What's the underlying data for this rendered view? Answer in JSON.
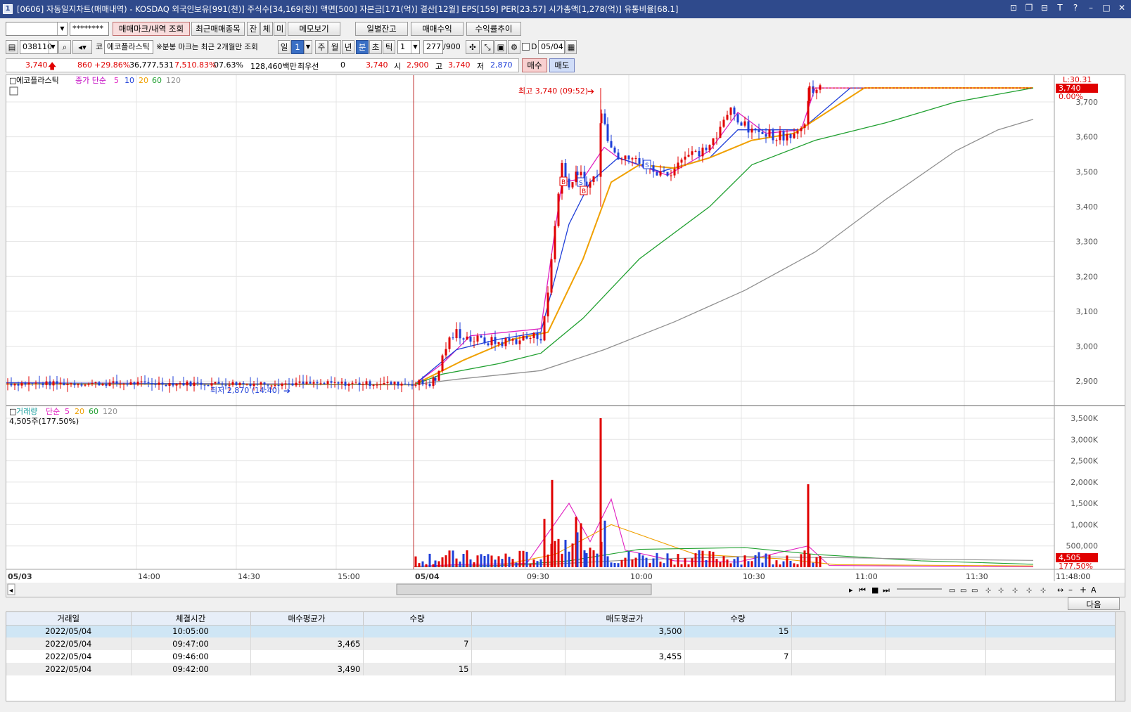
{
  "window": {
    "screen_no": "1",
    "title": "[0606] 자동일지차트(매매내역) - KOSDAQ 외국인보유[991(천)] 주식수[34,169(천)] 액면[500] 자본금[171(억)] 결산[12월] EPS[159] PER[23.57] 시가총액[1,278(억)] 유통비율[68.1]"
  },
  "toolbar1": {
    "account_value": "",
    "password_mask": "********",
    "btn_trade_mark": "매매마크/내역 조회",
    "btn_recent": "최근매매종목",
    "btn_jan": "잔",
    "btn_che": "체",
    "btn_mi": "미",
    "btn_memo": "메모보기",
    "btn_daily_balance": "일별잔고",
    "btn_trade_profit": "매매수익",
    "btn_return_trend": "수익률추이"
  },
  "toolbar2": {
    "code": "038110",
    "market_prefix": "코",
    "stock_name": "에코플라스틱",
    "notice": "※분봉 마크는 최근 2개월만 조회",
    "period_day": "일",
    "period_day_n": "1",
    "period_week": "주",
    "period_month": "월",
    "period_year": "년",
    "period_min": "분",
    "period_sec": "초",
    "period_tick": "틱",
    "interval": "1",
    "count": "277",
    "count_max": "/900",
    "d_label": "D",
    "date": "05/04"
  },
  "quote": {
    "price": "3,740",
    "change": "860",
    "change_pct": "+29.86%",
    "volume": "36,777,531",
    "vol_ratio": "7,510.83%",
    "turnover": "07.63%",
    "amount": "128,460백만",
    "priority_label": "최우선",
    "priority_val": "0",
    "priority_price": "3,740",
    "open_label": "시",
    "open": "2,900",
    "high_label": "고",
    "high": "3,740",
    "low_label": "저",
    "low": "2,870",
    "buy_btn": "매수",
    "sell_btn": "매도"
  },
  "price_legend": {
    "name": "에코플라스틱",
    "type": "종가 단순",
    "ma": [
      "5",
      "10",
      "20",
      "60",
      "120"
    ]
  },
  "volume_legend": {
    "name": "거래량",
    "type": "단순",
    "ma": [
      "5",
      "20",
      "60",
      "120"
    ],
    "current": "4,505주(177.50%)"
  },
  "annotations": {
    "high": "최고 3,740 (09:52)",
    "low": "최저 2,870 (14:40)",
    "cursor_box": "L:30.31",
    "last_price_box": "3,740",
    "last_pct_box": "0.00%",
    "last_vol_box": "4,505",
    "last_vol_pct_box": "177.50%"
  },
  "colors": {
    "up": "#e00000",
    "down": "#1f3fd8",
    "ma5": "#e020c0",
    "ma10": "#1f3fd8",
    "ma20": "#f0a000",
    "ma60": "#20a030",
    "ma120": "#909090"
  },
  "chart_data": [
    {
      "type": "candlestick",
      "y_ticks": [
        "3,700",
        "3,600",
        "3,500",
        "3,400",
        "3,300",
        "3,200",
        "3,100",
        "3,000",
        "2,900"
      ],
      "ylim": [
        2870,
        3800
      ],
      "x_ticks": [
        "05/03",
        "14:00",
        "14:30",
        "15:00",
        "05/04",
        "09:30",
        "10:00",
        "10:30",
        "11:00",
        "11:30",
        "11:48:00"
      ],
      "series": [
        {
          "name": "5",
          "values": []
        },
        {
          "name": "10",
          "values": []
        },
        {
          "name": "20",
          "values": []
        },
        {
          "name": "60",
          "values": []
        },
        {
          "name": "120",
          "values": []
        }
      ],
      "high_point": {
        "time": "09:52",
        "value": 3740
      },
      "low_point": {
        "time": "14:40",
        "value": 2870
      }
    },
    {
      "type": "bar",
      "y_ticks": [
        "3,500K",
        "3,000K",
        "2,500K",
        "2,000K",
        "1,500K",
        "1,000K",
        "500,000"
      ],
      "ylim": [
        0,
        3700000
      ],
      "peaks": [
        {
          "time": "09:52",
          "value": 3500000
        },
        {
          "time": "09:41",
          "value": 2050000
        },
        {
          "time": "10:42",
          "value": 1950000
        }
      ]
    }
  ],
  "nav": {
    "next_btn": "다음"
  },
  "table": {
    "headers": [
      "거래일",
      "체결시간",
      "매수평균가",
      "수량",
      "",
      "매도평균가",
      "수량",
      "",
      "",
      ""
    ],
    "rows": [
      [
        "2022/05/04",
        "10:05:00",
        "",
        "",
        "",
        "3,500",
        "15",
        "",
        "",
        ""
      ],
      [
        "2022/05/04",
        "09:47:00",
        "3,465",
        "7",
        "",
        "",
        "",
        "",
        "",
        ""
      ],
      [
        "2022/05/04",
        "09:46:00",
        "",
        "",
        "",
        "3,455",
        "7",
        "",
        "",
        ""
      ],
      [
        "2022/05/04",
        "09:42:00",
        "3,490",
        "15",
        "",
        "",
        "",
        "",
        "",
        ""
      ]
    ]
  }
}
